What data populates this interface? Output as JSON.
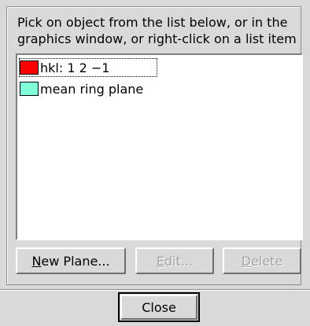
{
  "instructions": "Pick on object from the list below, or in the graphics window, or right-click on a list item",
  "list": {
    "items": [
      {
        "label": "hkl: 1 2 −1",
        "color": "#ff0000",
        "selected": true
      },
      {
        "label": "mean ring plane",
        "color": "#80ffd8",
        "selected": false
      }
    ]
  },
  "buttons": {
    "new_plane": {
      "mnemonic": "N",
      "rest": "ew Plane..."
    },
    "edit": {
      "mnemonic": "E",
      "rest": "dit...",
      "enabled": false
    },
    "delete": {
      "mnemonic": "D",
      "rest": "elete",
      "enabled": false
    },
    "close": "Close"
  }
}
